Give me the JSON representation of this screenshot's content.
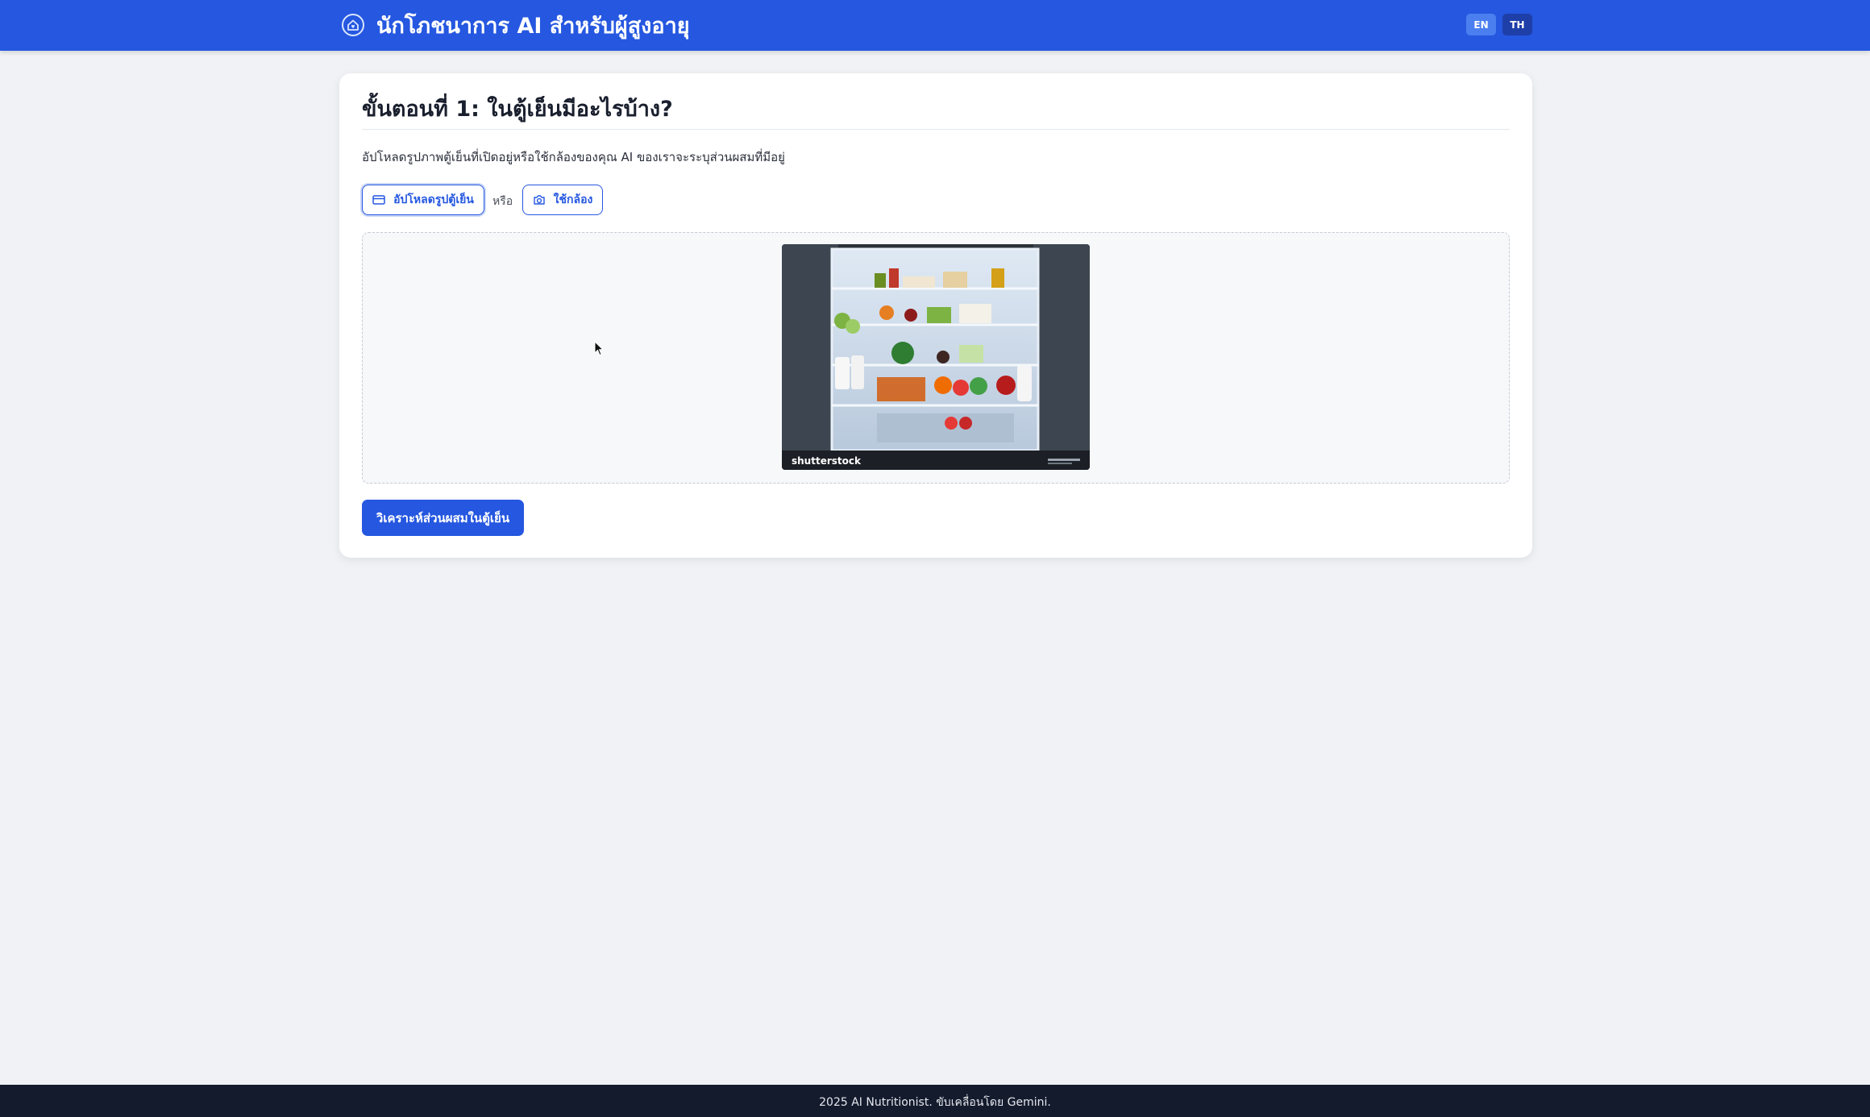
{
  "header": {
    "title": "นักโภชนาการ AI สำหรับผู้สูงอายุ",
    "logo_icon": "home-heart-icon",
    "lang_en": "EN",
    "lang_th": "TH",
    "active_lang": "TH"
  },
  "step": {
    "title": "ขั้นตอนที่ 1: ในตู้เย็นมีอะไรบ้าง?",
    "instruction": "อัปโหลดรูปภาพตู้เย็นที่เปิดอยู่หรือใช้กล้องของคุณ AI ของเราจะระบุส่วนผสมที่มีอยู่",
    "upload_label": "อัปโหลดรูปตู้เย็น",
    "upload_icon": "upload-card-icon",
    "or_text": "หรือ",
    "camera_label": "ใช้กล้อง",
    "camera_icon": "camera-icon",
    "preview_watermark": "shutterstock",
    "analyze_label": "วิเคราะห์ส่วนผสมในตู้เย็น"
  },
  "footer": {
    "text": "2025 AI Nutritionist. ขับเคลื่อนโดย Gemini."
  },
  "colors": {
    "primary": "#2557e0",
    "background": "#f0f2f5",
    "footer": "#141b2d"
  }
}
